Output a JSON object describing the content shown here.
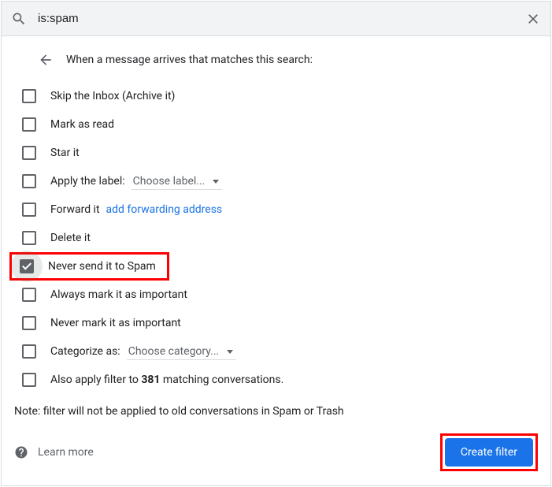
{
  "search": {
    "value": "is:spam"
  },
  "header": {
    "title": "When a message arrives that matches this search:"
  },
  "options": {
    "skip_inbox": {
      "label": "Skip the Inbox (Archive it)",
      "checked": false
    },
    "mark_read": {
      "label": "Mark as read",
      "checked": false
    },
    "star_it": {
      "label": "Star it",
      "checked": false
    },
    "apply_label": {
      "label": "Apply the label:",
      "dropdown": "Choose label...",
      "checked": false
    },
    "forward_it": {
      "label": "Forward it",
      "link": "add forwarding address",
      "checked": false
    },
    "delete_it": {
      "label": "Delete it",
      "checked": false
    },
    "never_spam": {
      "label": "Never send it to Spam",
      "checked": true
    },
    "always_important": {
      "label": "Always mark it as important",
      "checked": false
    },
    "never_important": {
      "label": "Never mark it as important",
      "checked": false
    },
    "categorize": {
      "label": "Categorize as:",
      "dropdown": "Choose category...",
      "checked": false
    },
    "also_apply_prefix": "Also apply filter to ",
    "also_apply_count": "381",
    "also_apply_suffix": " matching conversations."
  },
  "note": "Note: filter will not be applied to old conversations in Spam or Trash",
  "footer": {
    "learn_more": "Learn more",
    "create_filter": "Create filter"
  }
}
